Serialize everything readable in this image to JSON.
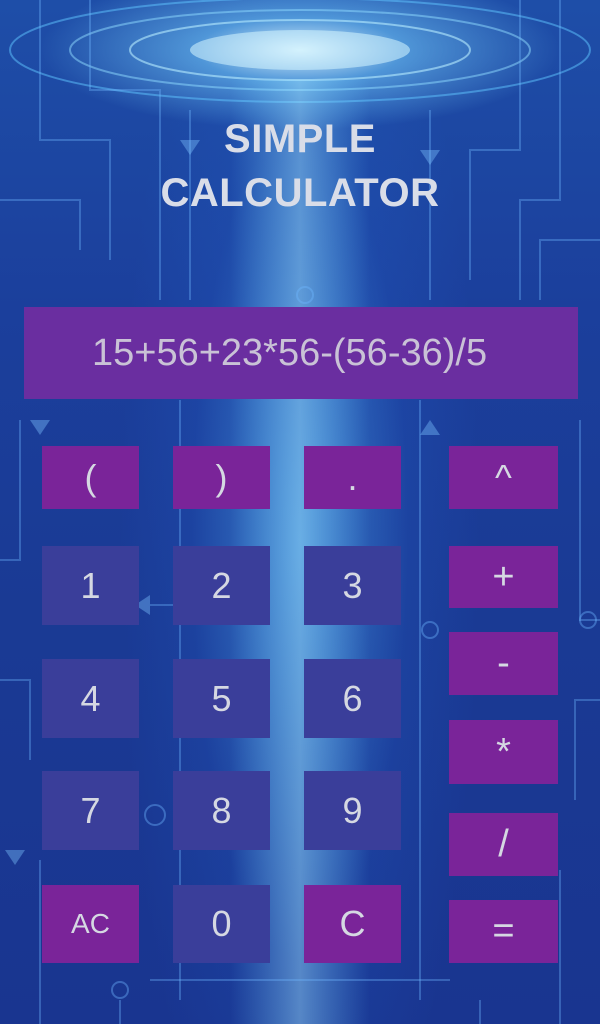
{
  "app": {
    "title_line1": "SIMPLE",
    "title_line2": "CALCULATOR"
  },
  "display": {
    "expression": "15+56+23*56-(56-36)/5"
  },
  "keys": {
    "open_paren": "(",
    "close_paren": ")",
    "decimal": ".",
    "power": "^",
    "one": "1",
    "two": "2",
    "three": "3",
    "plus": "+",
    "minus": "-",
    "four": "4",
    "five": "5",
    "six": "6",
    "multiply": "*",
    "seven": "7",
    "eight": "8",
    "nine": "9",
    "divide": "/",
    "all_clear": "AC",
    "zero": "0",
    "clear": "C",
    "equals": "="
  },
  "colors": {
    "display_bg": "#6a2ea0",
    "function_key": "#7a2499",
    "digit_key": "#3a3e9a",
    "text": "#d5d8e2"
  },
  "background": {
    "icon": "circuit-board-light-beam"
  }
}
